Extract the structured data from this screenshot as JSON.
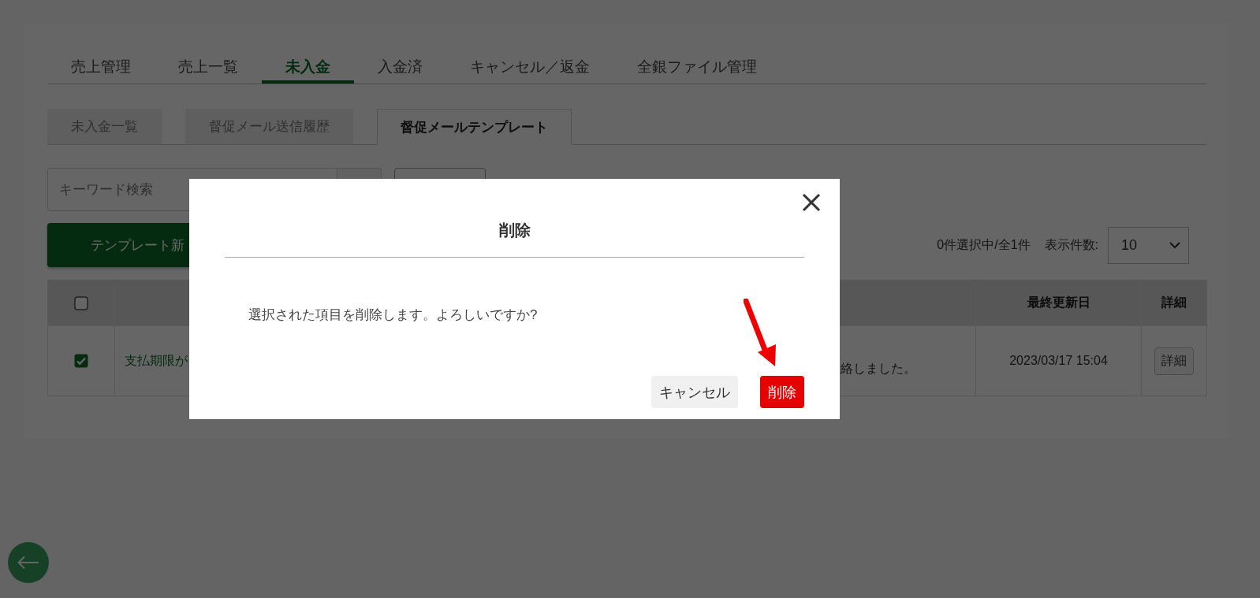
{
  "main_tabs": [
    {
      "label": "売上管理",
      "selected": false
    },
    {
      "label": "売上一覧",
      "selected": false
    },
    {
      "label": "未入金",
      "selected": true
    },
    {
      "label": "入金済",
      "selected": false
    },
    {
      "label": "キャンセル／返金",
      "selected": false
    },
    {
      "label": "全銀ファイル管理",
      "selected": false
    }
  ],
  "sub_tabs": [
    {
      "label": "未入金一覧",
      "selected": false
    },
    {
      "label": "督促メール送信履歴",
      "selected": false
    },
    {
      "label": "督促メールテンプレート",
      "selected": true
    }
  ],
  "search": {
    "placeholder": "キーワード検索"
  },
  "new_button": "テンプレート新",
  "selection_count": "0件選択中/全1件",
  "page_size": {
    "label": "表示件数:",
    "value": "10"
  },
  "table": {
    "header_checked": false,
    "columns": [
      "最終更新日",
      "詳細"
    ],
    "rows": [
      {
        "checked": true,
        "column_2": "支払期限が",
        "column_3": "絡しました。",
        "updated": "2023/03/17 15:04",
        "detail_button": "詳細"
      }
    ]
  },
  "dialog": {
    "title": "削除",
    "message": "選択された項目を削除します。よろしいですか?",
    "cancel_button": "キャンセル",
    "delete_button": "削除"
  }
}
